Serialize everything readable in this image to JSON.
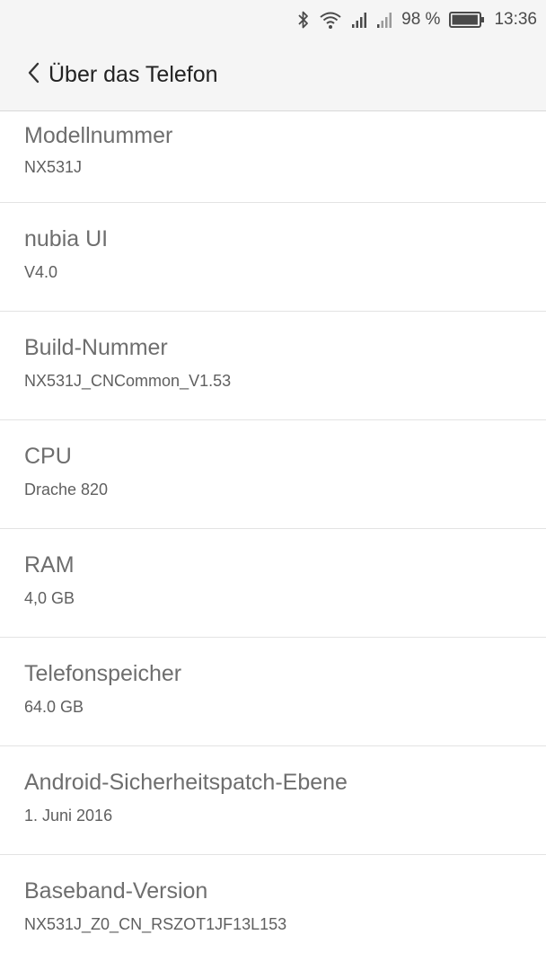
{
  "status_bar": {
    "battery_percent": "98 %",
    "time": "13:36",
    "battery_level": 0.98,
    "icons": [
      "bluetooth-icon",
      "wifi-icon",
      "signal-icon",
      "signal-icon",
      "battery-icon"
    ]
  },
  "header": {
    "title": "Über das Telefon",
    "back_icon": "chevron-left-icon"
  },
  "items": [
    {
      "title": "Modellnummer",
      "value": "NX531J"
    },
    {
      "title": "nubia UI",
      "value": "V4.0"
    },
    {
      "title": "Build-Nummer",
      "value": "NX531J_CNCommon_V1.53"
    },
    {
      "title": "CPU",
      "value": "Drache 820"
    },
    {
      "title": "RAM",
      "value": "4,0 GB"
    },
    {
      "title": "Telefonspeicher",
      "value": "64.0 GB"
    },
    {
      "title": "Android-Sicherheitspatch-Ebene",
      "value": "1. Juni 2016"
    },
    {
      "title": "Baseband-Version",
      "value": "NX531J_Z0_CN_RSZOT1JF13L153"
    }
  ],
  "colors": {
    "bar_background": "#f5f5f5",
    "title_text": "#6e6e6e",
    "divider": "#e3e3e3"
  }
}
